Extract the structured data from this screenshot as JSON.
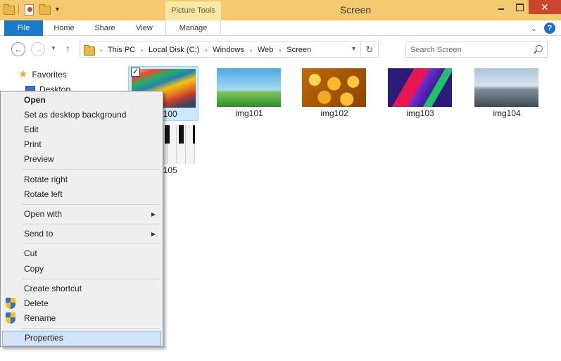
{
  "window": {
    "title": "Screen",
    "context_tab_group": "Picture Tools",
    "accent": "#f5c96e"
  },
  "ribbon": {
    "tabs": [
      {
        "label": "File"
      },
      {
        "label": "Home"
      },
      {
        "label": "Share"
      },
      {
        "label": "View"
      },
      {
        "label": "Manage"
      }
    ]
  },
  "address": {
    "crumbs": [
      "This PC",
      "Local Disk (C:)",
      "Windows",
      "Web",
      "Screen"
    ]
  },
  "search": {
    "placeholder": "Search Screen"
  },
  "nav": {
    "favorites": "Favorites",
    "desktop": "Desktop"
  },
  "files": [
    {
      "name": "img100",
      "selected": true
    },
    {
      "name": "img101"
    },
    {
      "name": "img102"
    },
    {
      "name": "img103"
    },
    {
      "name": "img104"
    },
    {
      "name": "img105"
    }
  ],
  "context_menu": {
    "items": [
      {
        "label": "Open"
      },
      {
        "label": "Set as desktop background"
      },
      {
        "label": "Edit"
      },
      {
        "label": "Print"
      },
      {
        "label": "Preview"
      },
      {
        "label": "Rotate right"
      },
      {
        "label": "Rotate left"
      },
      {
        "label": "Open with"
      },
      {
        "label": "Send to"
      },
      {
        "label": "Cut"
      },
      {
        "label": "Copy"
      },
      {
        "label": "Create shortcut"
      },
      {
        "label": "Delete"
      },
      {
        "label": "Rename"
      },
      {
        "label": "Properties"
      }
    ]
  }
}
